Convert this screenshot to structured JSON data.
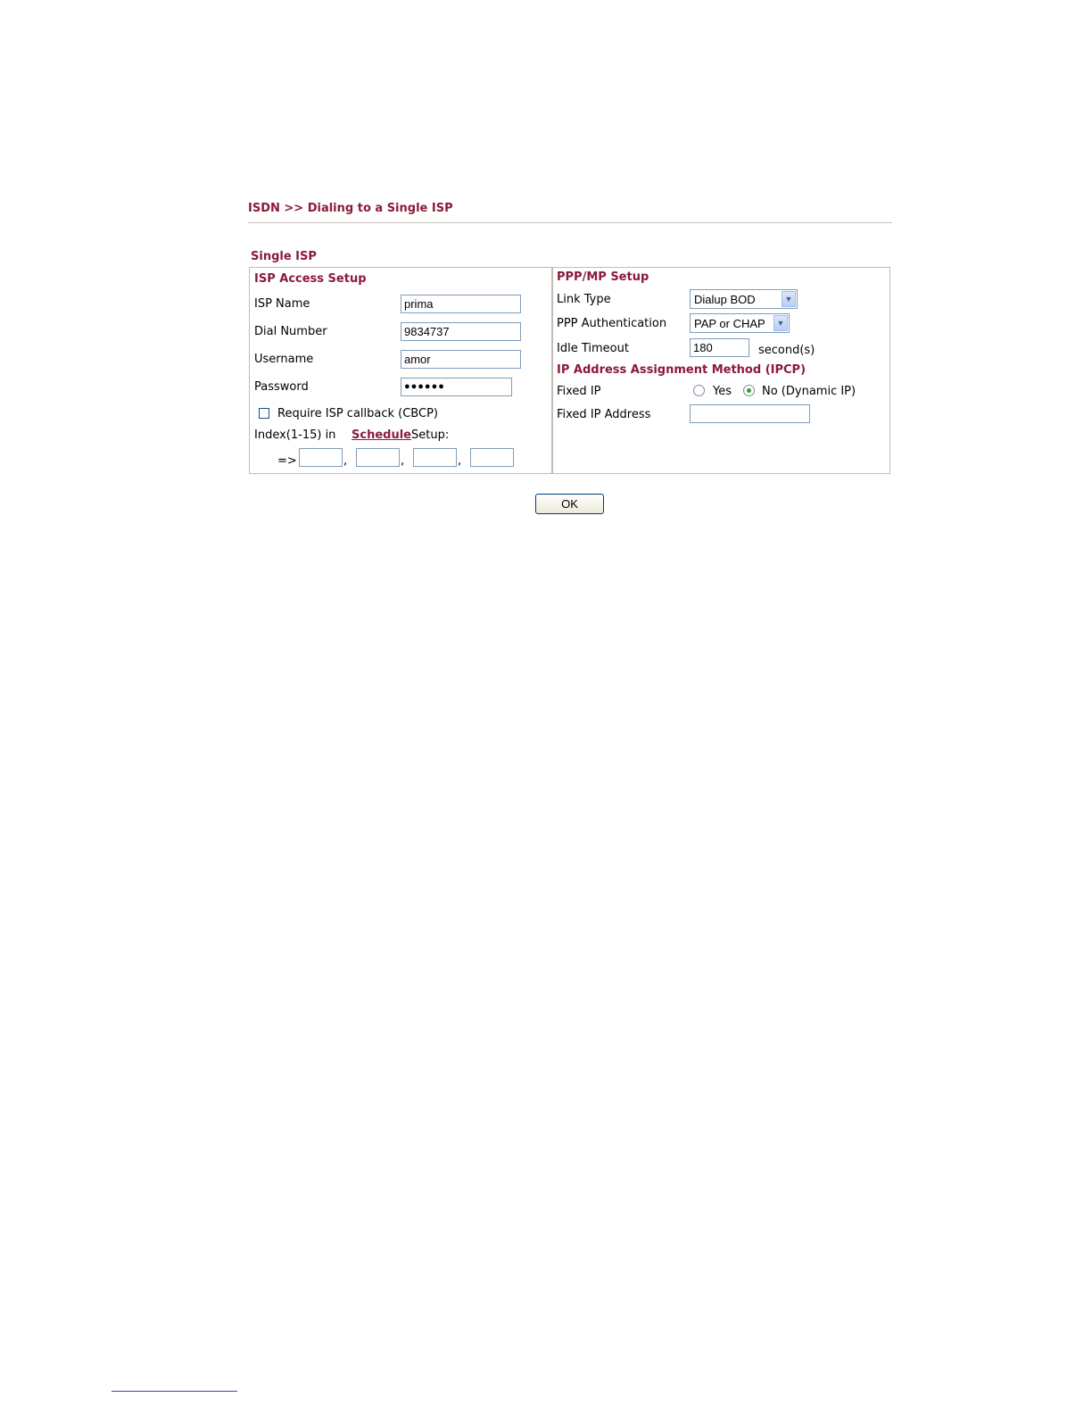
{
  "breadcrumb": "ISDN >> Dialing to a Single ISP",
  "section_title": "Single ISP",
  "isp_access": {
    "title": "ISP Access Setup",
    "isp_name_label": "ISP Name",
    "isp_name_value": "prima",
    "dial_number_label": "Dial Number",
    "dial_number_value": "9834737",
    "username_label": "Username",
    "username_value": "amor",
    "password_label": "Password",
    "password_value": "●●●●●●",
    "callback_label": "Require ISP callback (CBCP)",
    "index_prefix": "Index(1-15) in",
    "schedule_link": "Schedule",
    "index_suffix": "Setup:",
    "arrow": "=>",
    "comma": ","
  },
  "ppp_setup": {
    "title": "PPP/MP Setup",
    "link_type_label": "Link Type",
    "link_type_value": "Dialup BOD",
    "ppp_auth_label": "PPP Authentication",
    "ppp_auth_value": "PAP or CHAP",
    "idle_timeout_label": "Idle Timeout",
    "idle_timeout_value": "180",
    "idle_timeout_unit": "second(s)"
  },
  "ip_assignment": {
    "title": "IP Address Assignment Method (IPCP)",
    "fixed_ip_label": "Fixed IP",
    "yes_label": "Yes",
    "no_label": "No (Dynamic IP)",
    "fixed_ip_address_label": "Fixed IP Address",
    "fixed_ip_address_value": ""
  },
  "ok_button": "OK",
  "colors": {
    "title": "#8b1a3a",
    "border": "#c0bdb0",
    "radio_selected": "#2fa22f"
  },
  "icons": {
    "dropdown": "chevron-down-icon"
  }
}
